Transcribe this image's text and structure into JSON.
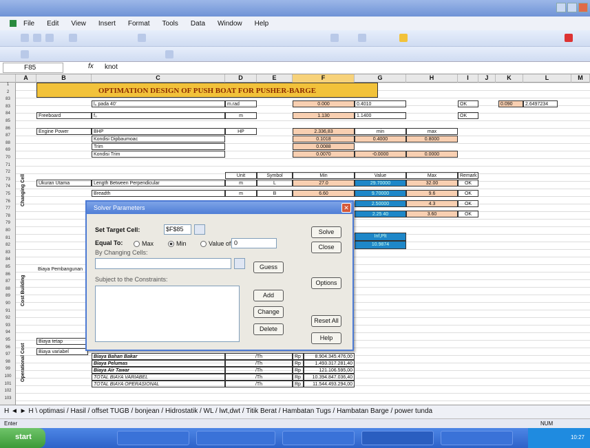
{
  "menu": [
    "File",
    "Edit",
    "View",
    "Insert",
    "Format",
    "Tools",
    "Data",
    "Window",
    "Help"
  ],
  "name_box": "F85",
  "fx": "fx",
  "formula_value": "knot",
  "columns": [
    "A",
    "B",
    "C",
    "D",
    "E",
    "F",
    "G",
    "H",
    "I",
    "J",
    "K",
    "L",
    "M"
  ],
  "row_numbers": [
    "1",
    "2",
    "83",
    "83",
    "84",
    "85",
    "86",
    "87",
    "88",
    "69",
    "70",
    "71",
    "72",
    "73",
    "74",
    "75",
    "76",
    "77",
    "78",
    "79",
    "80",
    "81",
    "82",
    "83",
    "84",
    "85",
    "86",
    "87",
    "88",
    "89",
    "90",
    "91",
    "92",
    "93",
    "94",
    "95",
    "96",
    "97",
    "98",
    "99",
    "100",
    "101",
    "102",
    "103"
  ],
  "sheet": {
    "banner": "OPTIMATION DESIGN OF PUSH BOAT FOR PUSHER-BARGE",
    "r1": {
      "label": "l₀ pada 40'",
      "unit": "m.rad",
      "value": "0.000",
      "g": "0.4010",
      "status": "OK",
      "k": "0.090",
      "l": "2.6497234"
    },
    "r2": {
      "label": "Freeboard",
      "sym": "f₀",
      "unit": "m",
      "value": "1.130",
      "g": "1.1400",
      "status": "OK"
    },
    "ep": {
      "label": "Engine Power",
      "c": "BHP",
      "unit": "HP",
      "value": "2.336,83",
      "min": "min",
      "max": "max"
    },
    "ep_rows": [
      {
        "c": "Kondisi Dipbaumoac",
        "v": "0.1018",
        "g": "0.4000",
        "h": "0.8000"
      },
      {
        "c": "Trim",
        "v": "0.0088"
      },
      {
        "c": "Kondisi Trim",
        "v": "0.0070",
        "g": "-0.0000",
        "h": "0.0000"
      }
    ],
    "headers": {
      "unit": "Unit",
      "symbol": "Symbol",
      "min": "Min",
      "value": "Value",
      "max": "Max",
      "remark": "Remark"
    },
    "uu_label": "Ukuran Utama",
    "uu_rows": [
      {
        "c": "Length Between Perpendicular",
        "u": "m",
        "s": "L",
        "min": "27.0",
        "val": "29.70000",
        "max": "32.00",
        "r": "OK"
      },
      {
        "c": "Breadth",
        "u": "m",
        "s": "B",
        "min": "6.60",
        "val": "9.70000",
        "max": "9.6",
        "r": "OK"
      },
      {
        "c": "",
        "u": "",
        "s": "",
        "min": "",
        "val": "2.50000",
        "max": "4.3",
        "r": "OK"
      },
      {
        "c": "",
        "u": "",
        "s": "",
        "min": "",
        "val": "2.25 40",
        "max": "3.60",
        "r": "OK"
      }
    ],
    "solver_target": {
      "a": "Inf,Plt",
      "b": "10.9874"
    },
    "vlabels": {
      "changing": "Changing Cell",
      "cost": "Cost Building",
      "opcost": "Operational Cost"
    },
    "b_biaya": "Biaya Pembangunan",
    "b_tetap": "Biaya tetap",
    "b_var": "Biaya variabel",
    "bottom": [
      {
        "c": "Biaya Bahan Bakar",
        "u": "/Th",
        "cur": "Rp",
        "v": "8.904.345.476,00"
      },
      {
        "c": "Biaya Pelumas",
        "u": "/Th",
        "cur": "Rp",
        "v": "1.493.317.281,40"
      },
      {
        "c": "Biaya Air Tawar",
        "u": "/Th",
        "cur": "Rp",
        "v": "121.106.595,00"
      },
      {
        "c": "TOTAL BIAYA VARIABEL",
        "u": "/Th",
        "cur": "Rp",
        "v": "10.394.847.036,40"
      },
      {
        "c": "TOTAL BIAYA OPERASIONAL",
        "u": "/Th",
        "cur": "Rp",
        "v": "11.544.493.294,00"
      }
    ]
  },
  "dialog": {
    "title": "Solver Parameters",
    "set_target": "Set Target Cell:",
    "target_value": "$F$85",
    "equal_to": "Equal To:",
    "max": "Max",
    "min": "Min",
    "value_of": "Value of:",
    "value_of_val": "0",
    "by_changing": "By Changing Cells:",
    "subject": "Subject to the Constraints:",
    "buttons": {
      "solve": "Solve",
      "close": "Close",
      "guess": "Guess",
      "options": "Options",
      "add": "Add",
      "change": "Change",
      "delete": "Delete",
      "reset": "Reset All",
      "help": "Help"
    }
  },
  "tabs": "H ◄ ► H \\ optimasi / Hasil / offset TUGB / bonjean / Hidrostatik / WL / lwt,dwt / Titik Berat / Hambatan Tugs / Hambatan Barge / power tunda",
  "status": {
    "left": "Enter",
    "right": "NUM"
  },
  "taskbar": {
    "start": "start",
    "clock": "10:27"
  },
  "colors": {
    "banner": "#f2c23a",
    "accent": "#4f7ed6",
    "cell_pink": "#f8cfb1",
    "cell_blue": "#1e87c8"
  }
}
